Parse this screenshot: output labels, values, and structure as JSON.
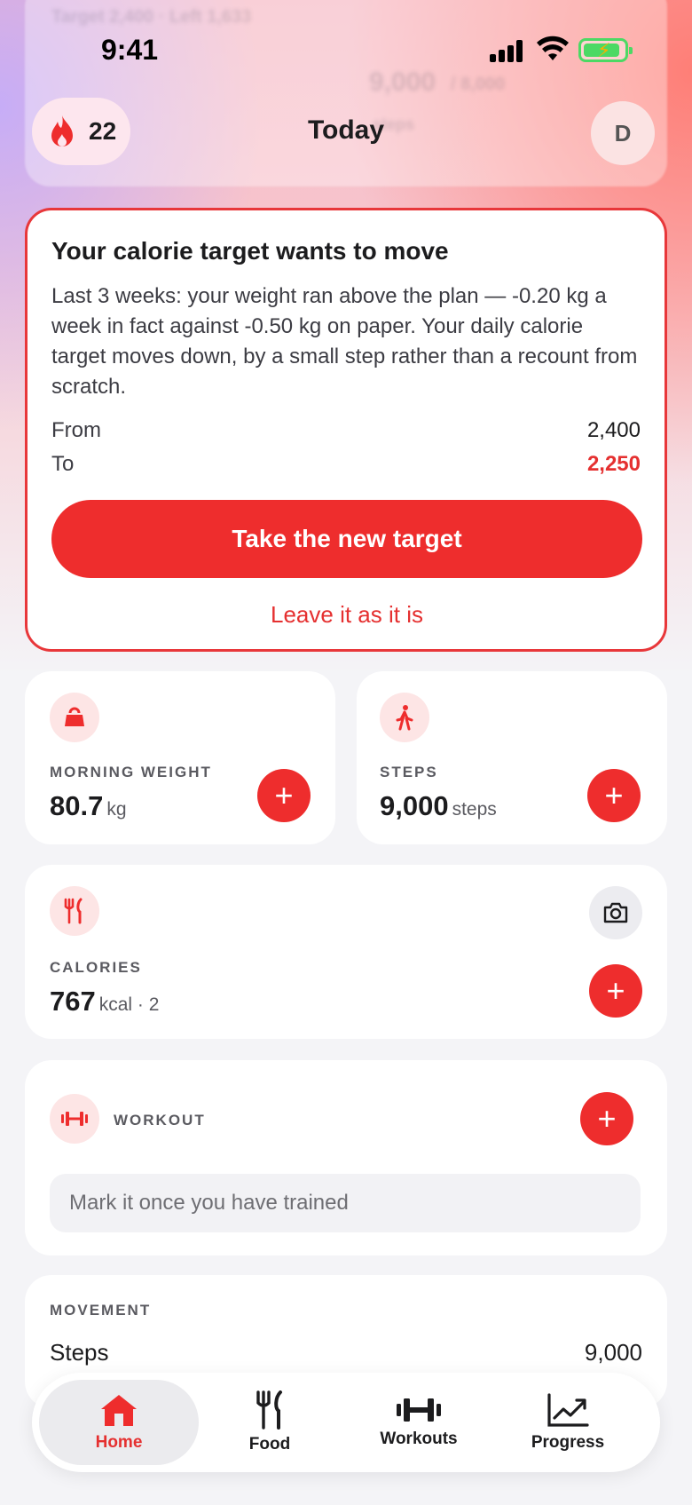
{
  "status_bar": {
    "time": "9:41"
  },
  "header": {
    "streak_count": "22",
    "title": "Today",
    "avatar_initial": "D"
  },
  "background_ghost": {
    "line1": "Target 2,400 · Left 1,633",
    "line2": "9,000",
    "line3": "/ 8,000",
    "line4": "steps"
  },
  "alert": {
    "title": "Your calorie target wants to move",
    "body": "Last 3 weeks: your weight ran above the plan — -0.20 kg a week in fact against -0.50 kg on paper. Your daily calorie target moves down, by a small step rather than a recount from scratch.",
    "from_label": "From",
    "from_value": "2,400",
    "to_label": "To",
    "to_value": "2,250",
    "primary_label": "Take the new target",
    "secondary_label": "Leave it as it is"
  },
  "weight": {
    "label": "MORNING WEIGHT",
    "value": "80.7",
    "unit": "kg",
    "add": "+"
  },
  "steps": {
    "label": "STEPS",
    "value": "9,000",
    "unit": "steps",
    "add": "+"
  },
  "calories": {
    "label": "CALORIES",
    "value": "767",
    "unit": "kcal · 2",
    "add": "+"
  },
  "workout": {
    "label": "WORKOUT",
    "placeholder": "Mark it once you have trained",
    "add": "+"
  },
  "movement": {
    "label": "MOVEMENT",
    "row_label": "Steps",
    "row_value": "9,000"
  },
  "tabs": [
    {
      "label": "Home",
      "icon": "house-icon",
      "active": true
    },
    {
      "label": "Food",
      "icon": "fork-knife-icon",
      "active": false
    },
    {
      "label": "Workouts",
      "icon": "dumbbell-icon",
      "active": false
    },
    {
      "label": "Progress",
      "icon": "chart-line-icon",
      "active": false
    }
  ],
  "colors": {
    "accent": "#ee2d2d",
    "accent_soft": "#fde5e5",
    "background": "#f4f4f7",
    "card": "#ffffff"
  }
}
